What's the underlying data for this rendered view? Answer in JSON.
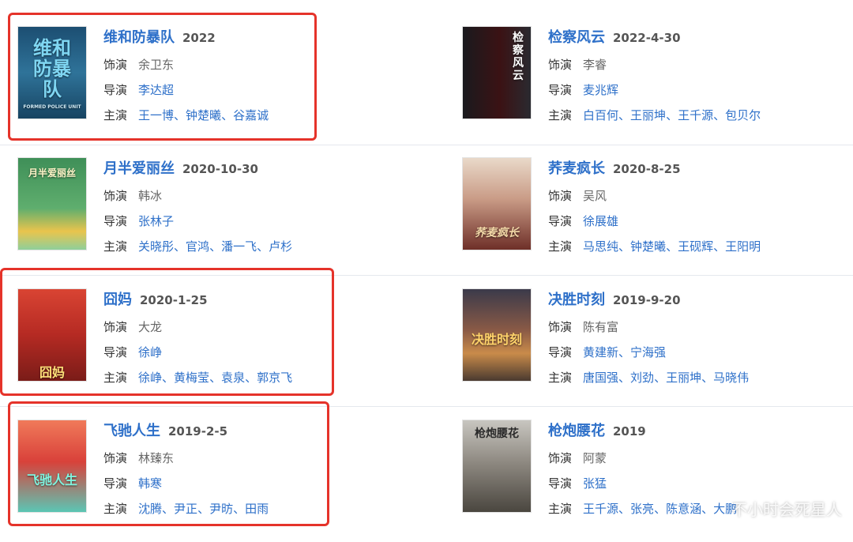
{
  "labels": {
    "role": "饰演",
    "director": "导演",
    "cast": "主演"
  },
  "movies": [
    {
      "title": "维和防暴队",
      "date": "2022",
      "role": "余卫东",
      "director": [
        "李达超"
      ],
      "cast": [
        "王一博",
        "钟楚曦",
        "谷嘉诚"
      ],
      "poster_text": "维和防暴队",
      "poster_sub": "FORMED POLICE UNIT"
    },
    {
      "title": "检察风云",
      "date": "2022-4-30",
      "role": "李睿",
      "director": [
        "麦兆辉"
      ],
      "cast": [
        "白百何",
        "王丽坤",
        "王千源",
        "包贝尔"
      ],
      "poster_text": "检察风云"
    },
    {
      "title": "月半爱丽丝",
      "date": "2020-10-30",
      "role": "韩冰",
      "director": [
        "张林子"
      ],
      "cast": [
        "关晓彤",
        "官鸿",
        "潘一飞",
        "卢杉"
      ],
      "poster_text": "月半爱丽丝"
    },
    {
      "title": "荞麦疯长",
      "date": "2020-8-25",
      "role": "吴风",
      "director": [
        "徐展雄"
      ],
      "cast": [
        "马思纯",
        "钟楚曦",
        "王砚辉",
        "王阳明"
      ],
      "poster_text": "荞麦疯长"
    },
    {
      "title": "囧妈",
      "date": "2020-1-25",
      "role": "大龙",
      "director": [
        "徐峥"
      ],
      "cast": [
        "徐峥",
        "黄梅莹",
        "袁泉",
        "郭京飞"
      ],
      "poster_text": "囧妈"
    },
    {
      "title": "决胜时刻",
      "date": "2019-9-20",
      "role": "陈有富",
      "director": [
        "黄建新",
        "宁海强"
      ],
      "cast": [
        "唐国强",
        "刘劲",
        "王丽坤",
        "马晓伟"
      ],
      "poster_text": "决胜时刻"
    },
    {
      "title": "飞驰人生",
      "date": "2019-2-5",
      "role": "林臻东",
      "director": [
        "韩寒"
      ],
      "cast": [
        "沈腾",
        "尹正",
        "尹昉",
        "田雨"
      ],
      "poster_text": "飞驰人生"
    },
    {
      "title": "枪炮腰花",
      "date": "2019",
      "role": "阿蒙",
      "director": [
        "张猛"
      ],
      "cast": [
        "王千源",
        "张亮",
        "陈意涵",
        "大鹏"
      ],
      "poster_text": "枪炮腰花"
    }
  ],
  "watermark": "不小时会死星人"
}
